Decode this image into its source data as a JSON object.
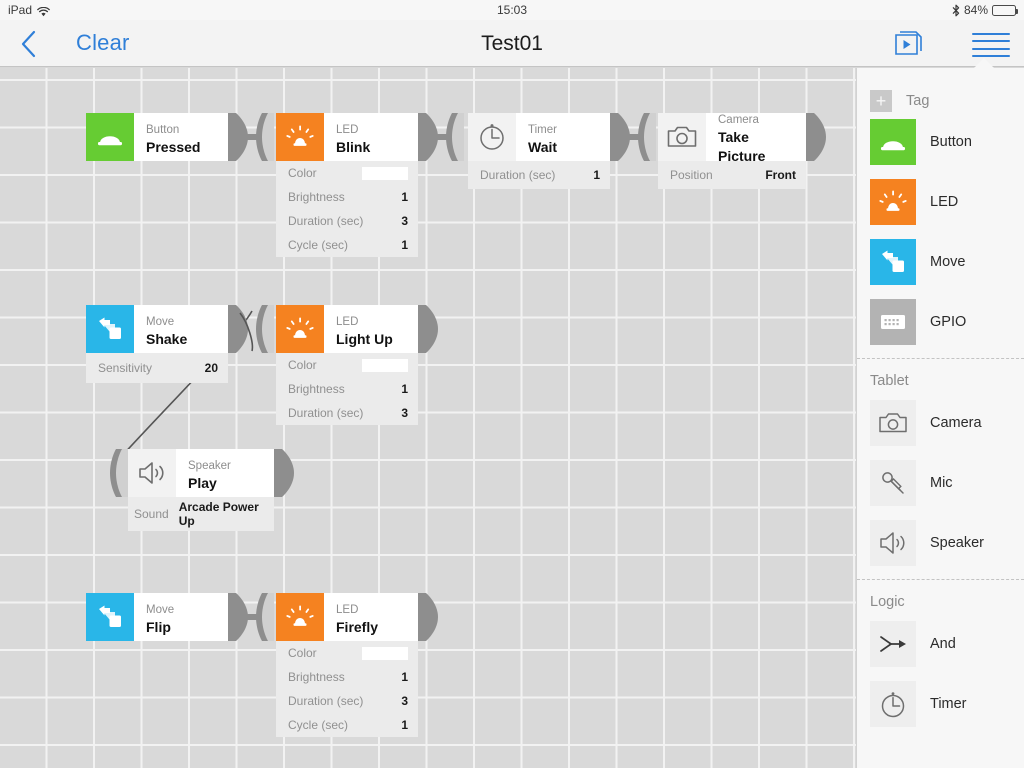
{
  "status_bar": {
    "carrier": "iPad",
    "wifi_icon": "wifi-icon",
    "time": "15:03",
    "bluetooth_icon": "bluetooth-icon",
    "battery_percent": "84%",
    "battery_icon": "battery-icon"
  },
  "nav": {
    "back_icon": "chevron-left-icon",
    "clear_label": "Clear",
    "title": "Test01",
    "play_icon": "play-stack-icon",
    "menu_icon": "hamburger-menu-icon"
  },
  "colors": {
    "button_green": "#66cc33",
    "led_orange": "#f58220",
    "move_blue": "#29b6e8",
    "gpio_gray": "#b3b3b3",
    "accent_blue": "#2f7fd8",
    "canvas": "#d9d9d9",
    "grid_line": "#f2f2f2",
    "panel_bg": "#ebebeb"
  },
  "canvas": {
    "blocks": [
      {
        "id": "button-pressed",
        "category": "Button",
        "action": "Pressed",
        "icon": "button-icon",
        "tile_color": "#66cc33",
        "params": []
      },
      {
        "id": "led-blink",
        "category": "LED",
        "action": "Blink",
        "icon": "led-icon",
        "tile_color": "#f58220",
        "params": [
          {
            "key": "Color",
            "value": "",
            "type": "swatch",
            "swatch_color": "#ffffff"
          },
          {
            "key": "Brightness",
            "value": "1",
            "type": "number"
          },
          {
            "key": "Duration (sec)",
            "value": "3",
            "type": "number"
          },
          {
            "key": "Cycle (sec)",
            "value": "1",
            "type": "number"
          }
        ]
      },
      {
        "id": "timer-wait",
        "category": "Timer",
        "action": "Wait",
        "icon": "timer-icon",
        "tile_color": "#f2f2f2",
        "params": [
          {
            "key": "Duration (sec)",
            "value": "1",
            "type": "number"
          }
        ]
      },
      {
        "id": "camera-take-picture",
        "category": "Camera",
        "action": "Take Picture",
        "icon": "camera-icon",
        "tile_color": "#f2f2f2",
        "params": [
          {
            "key": "Position",
            "value": "Front",
            "type": "text"
          }
        ]
      },
      {
        "id": "move-shake",
        "category": "Move",
        "action": "Shake",
        "icon": "move-icon",
        "tile_color": "#29b6e8",
        "params": [
          {
            "key": "Sensitivity",
            "value": "20",
            "type": "number"
          }
        ]
      },
      {
        "id": "led-light-up",
        "category": "LED",
        "action": "Light Up",
        "icon": "led-icon",
        "tile_color": "#f58220",
        "params": [
          {
            "key": "Color",
            "value": "",
            "type": "swatch",
            "swatch_color": "#ffffff"
          },
          {
            "key": "Brightness",
            "value": "1",
            "type": "number"
          },
          {
            "key": "Duration (sec)",
            "value": "3",
            "type": "number"
          }
        ]
      },
      {
        "id": "speaker-play",
        "category": "Speaker",
        "action": "Play",
        "icon": "speaker-icon",
        "tile_color": "#f2f2f2",
        "params": [
          {
            "key": "Sound",
            "value": "Arcade Power Up",
            "type": "text"
          }
        ]
      },
      {
        "id": "move-flip",
        "category": "Move",
        "action": "Flip",
        "icon": "move-icon",
        "tile_color": "#29b6e8",
        "params": []
      },
      {
        "id": "led-firefly",
        "category": "LED",
        "action": "Firefly",
        "icon": "led-icon",
        "tile_color": "#f58220",
        "params": [
          {
            "key": "Color",
            "value": "",
            "type": "swatch",
            "swatch_color": "#ffffff"
          },
          {
            "key": "Brightness",
            "value": "1",
            "type": "number"
          },
          {
            "key": "Duration (sec)",
            "value": "3",
            "type": "number"
          },
          {
            "key": "Cycle (sec)",
            "value": "1",
            "type": "number"
          }
        ]
      }
    ]
  },
  "sidebar": {
    "tag": {
      "plus_icon": "plus-icon",
      "label": "Tag"
    },
    "devices": [
      {
        "name": "Button",
        "icon": "button-icon",
        "tile_color": "#66cc33",
        "battery": "low"
      },
      {
        "name": "LED",
        "icon": "led-icon",
        "tile_color": "#f58220",
        "battery": "low"
      },
      {
        "name": "Move",
        "icon": "move-icon",
        "tile_color": "#29b6e8",
        "battery": "slant"
      },
      {
        "name": "GPIO",
        "icon": "gpio-icon",
        "tile_color": "#b3b3b3",
        "battery": "slant"
      }
    ],
    "groups": [
      {
        "label": "Tablet",
        "items": [
          {
            "name": "Camera",
            "icon": "camera-icon"
          },
          {
            "name": "Mic",
            "icon": "mic-icon"
          },
          {
            "name": "Speaker",
            "icon": "speaker-icon"
          }
        ]
      },
      {
        "label": "Logic",
        "items": [
          {
            "name": "And",
            "icon": "and-gate-icon"
          },
          {
            "name": "Timer",
            "icon": "timer-icon"
          }
        ]
      }
    ]
  }
}
